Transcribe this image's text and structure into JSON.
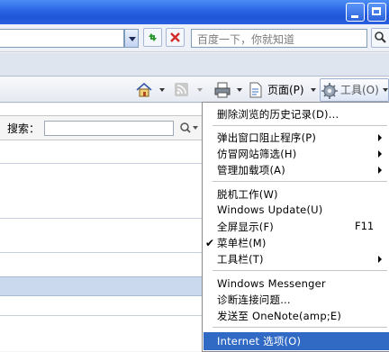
{
  "search": {
    "placeholder": "百度一下，你就知道"
  },
  "command_bar": {
    "page_label": "页面(P)",
    "tools_label": "工具(O)"
  },
  "findbar": {
    "label": "搜索："
  },
  "tools_menu": {
    "items": [
      {
        "label": "删除浏览的历史记录(D)..."
      },
      {
        "label": "弹出窗口阻止程序(P)",
        "submenu": true
      },
      {
        "label": "仿冒网站筛选(H)",
        "submenu": true
      },
      {
        "label": "管理加载项(A)",
        "submenu": true
      },
      {
        "label": "脱机工作(W)"
      },
      {
        "label": "Windows Update(U)"
      },
      {
        "label": "全屏显示(F)",
        "shortcut": "F11"
      },
      {
        "label": "菜单栏(M)",
        "checked": true
      },
      {
        "label": "工具栏(T)",
        "submenu": true
      },
      {
        "label": "Windows Messenger"
      },
      {
        "label": "诊断连接问题..."
      },
      {
        "label": "发送至 OneNote(amp;E)"
      },
      {
        "label": "Internet 选项(O)",
        "highlighted": true
      }
    ]
  },
  "colors": {
    "title_bar": "#2a64e3",
    "menu_highlight": "#316ac5"
  }
}
